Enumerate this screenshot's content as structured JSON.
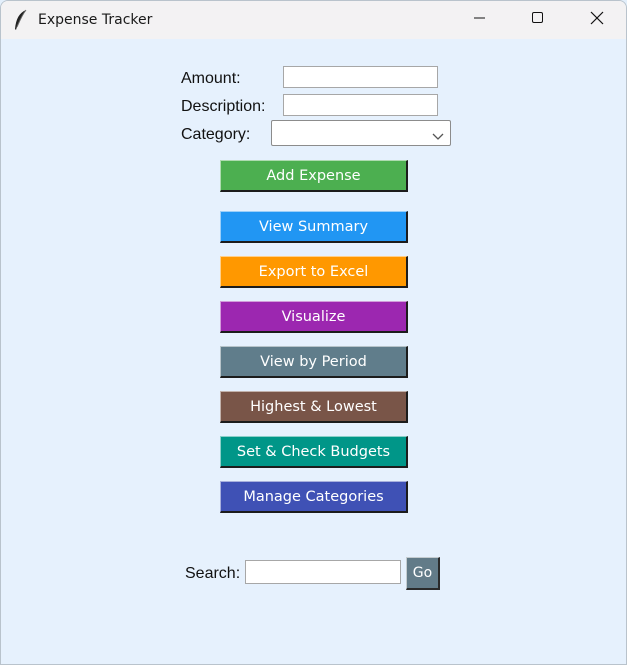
{
  "window": {
    "title": "Expense Tracker",
    "app_icon": "feather-icon",
    "controls": [
      "minimize-icon",
      "maximize-icon",
      "close-icon"
    ]
  },
  "form": {
    "amount_label": "Amount:",
    "amount_value": "",
    "description_label": "Description:",
    "description_value": "",
    "category_label": "Category:",
    "category_value": ""
  },
  "buttons": [
    {
      "label": "Add Expense",
      "color": "#4caf50"
    },
    {
      "label": "View Summary",
      "color": "#2196f3"
    },
    {
      "label": "Export to Excel",
      "color": "#ff9800"
    },
    {
      "label": "Visualize",
      "color": "#9c27b0"
    },
    {
      "label": "View by Period",
      "color": "#607d8b"
    },
    {
      "label": "Highest & Lowest",
      "color": "#795548"
    },
    {
      "label": "Set & Check Budgets",
      "color": "#009688"
    },
    {
      "label": "Manage Categories",
      "color": "#3f51b5"
    }
  ],
  "search": {
    "label": "Search:",
    "value": "",
    "go_label": "Go"
  }
}
